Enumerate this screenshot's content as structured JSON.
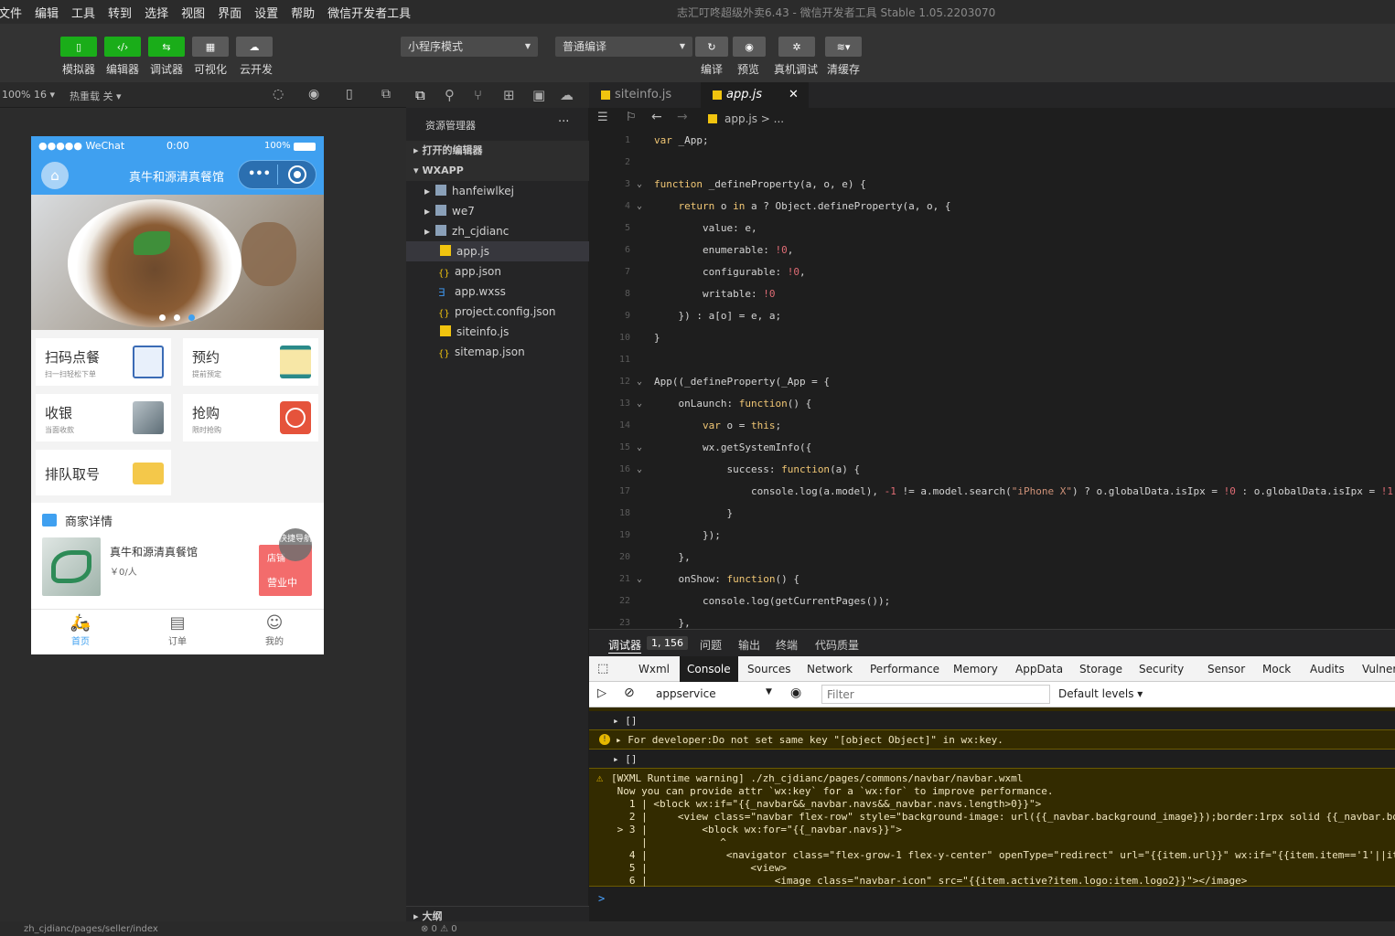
{
  "menubar": {
    "items": [
      "文件",
      "编辑",
      "工具",
      "转到",
      "选择",
      "视图",
      "界面",
      "设置",
      "帮助",
      "微信开发者工具"
    ],
    "title": "志汇叮咚超级外卖6.43 - 微信开发者工具 Stable 1.05.2203070"
  },
  "toolbar": {
    "left": [
      "模拟器",
      "编辑器",
      "调试器",
      "可视化",
      "云开发"
    ],
    "mode": "小程序模式",
    "compile": "普通编译",
    "right": [
      "编译",
      "预览",
      "真机调试",
      "清缓存"
    ]
  },
  "simbar": {
    "zoom": "100% 16 ▾",
    "hotreload": "热重载 关 ▾"
  },
  "phone": {
    "signal": "●●●●● WeChat",
    "time": "0:00",
    "battery": "100%",
    "title": "真牛和源清真餐馆",
    "cards": [
      {
        "title": "扫码点餐",
        "sub": "扫一扫轻松下单"
      },
      {
        "title": "预约",
        "sub": "提前预定"
      },
      {
        "title": "收银",
        "sub": "当面收款"
      },
      {
        "title": "抢购",
        "sub": "限时抢购"
      },
      {
        "title": "排队取号",
        "sub": ""
      }
    ],
    "merchant": {
      "section": "商家详情",
      "name": "真牛和源清真餐馆",
      "price": "￥0/人",
      "float": "快捷导航",
      "shop_btn": "店铺",
      "status": "营业中"
    },
    "tabs": [
      "首页",
      "订单",
      "我的"
    ]
  },
  "explorer": {
    "header": "资源管理器",
    "open": "打开的编辑器",
    "project": "WXAPP",
    "folders": [
      "hanfeiwlkej",
      "we7",
      "zh_cjdianc"
    ],
    "files": [
      "app.js",
      "app.json",
      "app.wxss",
      "project.config.json",
      "siteinfo.js",
      "sitemap.json"
    ],
    "outline": "大纲"
  },
  "tabs": {
    "tab1": "siteinfo.js",
    "tab2": "app.js",
    "close": "✕"
  },
  "crumbs": {
    "path": "app.js > ..."
  },
  "editor": {
    "lines": [
      "var _App;",
      "",
      "function _defineProperty(a, o, e) {",
      "    return o in a ? Object.defineProperty(a, o, {",
      "        value: e,",
      "        enumerable: !0,",
      "        configurable: !0,",
      "        writable: !0",
      "    }) : a[o] = e, a;",
      "}",
      "",
      "App((_defineProperty(_App = {",
      "    onLaunch: function() {",
      "        var o = this;",
      "        wx.getSystemInfo({",
      "            success: function(a) {",
      "                console.log(a.model), -1 != a.model.search(\"iPhone X\") ? o.globalData.isIpx = !0 : o.globalData.isIpx = !1;",
      "            }",
      "        });",
      "    },",
      "    onShow: function() {",
      "        console.log(getCurrentPages());",
      "    },"
    ]
  },
  "panel": {
    "debug": "调试器",
    "badge": "1, 156",
    "items": [
      "问题",
      "输出",
      "终端",
      "代码质量"
    ]
  },
  "devtabs": [
    "Wxml",
    "Console",
    "Sources",
    "Network",
    "Performance",
    "Memory",
    "AppData",
    "Storage",
    "Security",
    "Sensor",
    "Mock",
    "Audits",
    "Vulner"
  ],
  "consolebar": {
    "context": "appservice",
    "filter_placeholder": "Filter",
    "levels": "Default levels ▾"
  },
  "console": {
    "arr1": "▸ []",
    "dev": "▸ For developer:Do not set same key \"[object Object]\" in wx:key.",
    "arr2": "▸ []",
    "warn_title": "[WXML Runtime warning] ./zh_cjdianc/pages/commons/navbar/navbar.wxml",
    "warn_msg": " Now you can provide attr `wx:key` for a `wx:for` to improve performance.",
    "w1": "   1 | <block wx:if=\"{{_navbar&&_navbar.navs&&_navbar.navs.length>0}}\">",
    "w2": "   2 |     <view class=\"navbar flex-row\" style=\"background-image: url({{_navbar.background_image}});border:1rpx solid {{_navbar.bor",
    "w3": " > 3 |         <block wx:for=\"{{_navbar.navs}}\">",
    "w3b": "     |            ^",
    "w4": "   4 |             <navigator class=\"flex-grow-1 flex-y-center\" openType=\"redirect\" url=\"{{item.url}}\" wx:if=\"{{item.item=='1'||ite",
    "w5": "   5 |                 <view>",
    "w6": "   6 |                     <image class=\"navbar-icon\" src=\"{{item.active?item.logo:item.logo2}}\"></image>",
    "prompt": ">"
  },
  "status": {
    "path": "zh_cjdianc/pages/seller/index",
    "errors": "⊗ 0 ⚠ 0"
  }
}
